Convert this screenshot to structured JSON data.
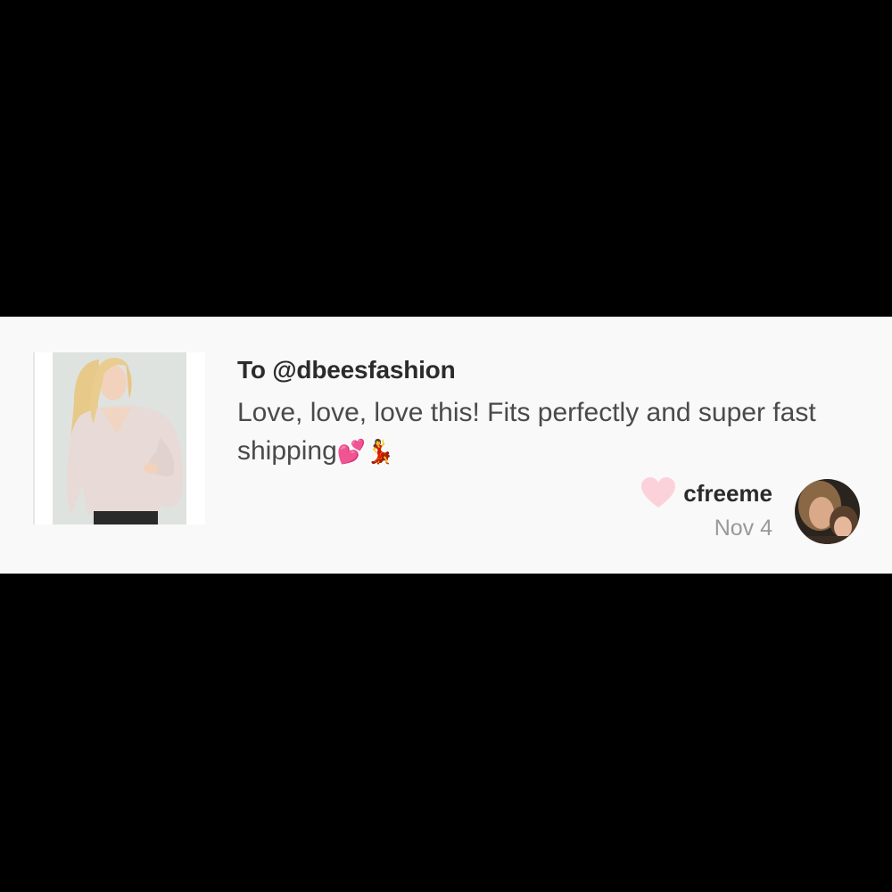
{
  "review": {
    "recipient": "To @dbeesfashion",
    "text": "Love, love, love this! Fits perfectly and super fast shipping",
    "emoji": "💕💃",
    "username": "cfreeme",
    "date": "Nov 4"
  },
  "icons": {
    "heart": "heart-icon",
    "product_photo": "sweater-product-photo",
    "avatar": "user-avatar"
  },
  "colors": {
    "background": "#000000",
    "card": "#f9f9f9",
    "heart": "#fcd2da",
    "primary_text": "#2b2b2b",
    "secondary_text": "#999999"
  }
}
